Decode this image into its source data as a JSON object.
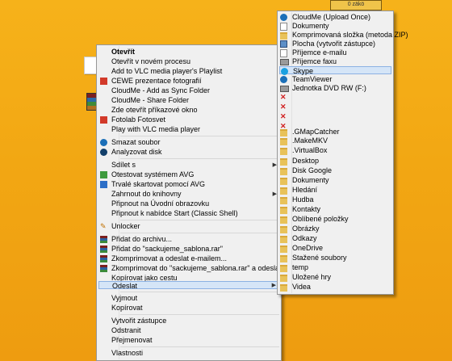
{
  "desktop": {
    "topbar_text": "0 zäkö"
  },
  "context_menu": {
    "items": [
      {
        "label": "Otevřít",
        "bold": true,
        "icon": "",
        "arrow": false
      },
      {
        "label": "Otevřít v novém procesu",
        "icon": "",
        "arrow": false
      },
      {
        "label": "Add to VLC media player's Playlist",
        "icon": "",
        "arrow": false
      },
      {
        "label": "CEWE prezentace fotografií",
        "icon": "cewe-icon",
        "arrow": false
      },
      {
        "label": "CloudMe - Add as Sync Folder",
        "icon": "",
        "arrow": false
      },
      {
        "label": "CloudMe - Share Folder",
        "icon": "",
        "arrow": false
      },
      {
        "label": "Zde otevřít příkazové okno",
        "icon": "",
        "arrow": false
      },
      {
        "label": "Fotolab Fotosvet",
        "icon": "fotolab-icon",
        "arrow": false
      },
      {
        "label": "Play with VLC media player",
        "icon": "",
        "arrow": false
      },
      {
        "label": "Smazat soubor",
        "icon": "delete-icon",
        "arrow": false
      },
      {
        "label": "Analyzovat disk",
        "icon": "analyze-icon",
        "arrow": false
      },
      {
        "label": "Sdílet s",
        "icon": "",
        "arrow": true
      },
      {
        "label": "Otestovat systémem AVG",
        "icon": "avg-icon",
        "arrow": false
      },
      {
        "label": "Trvalé skartovat pomocí AVG",
        "icon": "shred-icon",
        "arrow": false
      },
      {
        "label": "Zahrnout do knihovny",
        "icon": "",
        "arrow": true
      },
      {
        "label": "Připnout na Úvodní obrazovku",
        "icon": "",
        "arrow": false
      },
      {
        "label": "Připnout k nabídce Start (Classic Shell)",
        "icon": "",
        "arrow": false
      },
      {
        "label": "Unlocker",
        "icon": "unlocker-icon",
        "arrow": false
      },
      {
        "label": "Přidat do archivu...",
        "icon": "winrar-icon",
        "arrow": false
      },
      {
        "label": "Přidat do \"sackujeme_sablona.rar\"",
        "icon": "winrar-icon",
        "arrow": false
      },
      {
        "label": "Zkomprimovat a odeslat e-mailem...",
        "icon": "winrar-icon",
        "arrow": false
      },
      {
        "label": "Zkomprimovat do \"sackujeme_sablona.rar\" a odeslat e-mailem",
        "icon": "winrar-icon",
        "arrow": false
      },
      {
        "label": "Kopírovat jako cestu",
        "icon": "",
        "arrow": false
      },
      {
        "label": "Odeslat",
        "icon": "",
        "arrow": true,
        "highlighted": true
      },
      {
        "label": "Vyjmout",
        "icon": "",
        "arrow": false
      },
      {
        "label": "Kopírovat",
        "icon": "",
        "arrow": false
      },
      {
        "label": "Vytvořit zástupce",
        "icon": "",
        "arrow": false
      },
      {
        "label": "Odstranit",
        "icon": "",
        "arrow": false
      },
      {
        "label": "Přejmenovat",
        "icon": "",
        "arrow": false
      },
      {
        "label": "Vlastnosti",
        "icon": "",
        "arrow": false
      }
    ]
  },
  "send_to_menu": {
    "items": [
      {
        "label": "CloudMe (Upload Once)",
        "icon": "cloudme-icon"
      },
      {
        "label": "Dokumenty",
        "icon": "documents-icon"
      },
      {
        "label": "Komprimovaná složka (metoda ZIP)",
        "icon": "zip-folder-icon"
      },
      {
        "label": "Plocha (vytvořit zástupce)",
        "icon": "desktop-icon"
      },
      {
        "label": "Příjemce e-mailu",
        "icon": "mail-icon"
      },
      {
        "label": "Příjemce faxu",
        "icon": "fax-icon"
      },
      {
        "label": "Skype",
        "icon": "skype-icon",
        "highlighted": true
      },
      {
        "label": "TeamViewer",
        "icon": "teamviewer-icon"
      },
      {
        "label": "Jednotka DVD RW (F:)",
        "icon": "dvd-drive-icon"
      },
      {
        "label": "",
        "icon": "broken-shortcut-icon"
      },
      {
        "label": "",
        "icon": "broken-shortcut-icon"
      },
      {
        "label": "",
        "icon": "broken-shortcut-icon"
      },
      {
        "label": "",
        "icon": "broken-shortcut-icon"
      },
      {
        "label": ".GMapCatcher",
        "icon": "folder-icon"
      },
      {
        "label": ".MakeMKV",
        "icon": "folder-icon"
      },
      {
        "label": ".VirtualBox",
        "icon": "folder-icon"
      },
      {
        "label": "Desktop",
        "icon": "folder-icon"
      },
      {
        "label": "Disk Google",
        "icon": "folder-icon"
      },
      {
        "label": "Dokumenty",
        "icon": "folder-icon"
      },
      {
        "label": "Hledání",
        "icon": "folder-icon"
      },
      {
        "label": "Hudba",
        "icon": "folder-icon"
      },
      {
        "label": "Kontakty",
        "icon": "folder-icon"
      },
      {
        "label": "Oblíbené položky",
        "icon": "folder-icon"
      },
      {
        "label": "Obrázky",
        "icon": "folder-icon"
      },
      {
        "label": "Odkazy",
        "icon": "folder-icon"
      },
      {
        "label": "OneDrive",
        "icon": "folder-icon"
      },
      {
        "label": "Stažené soubory",
        "icon": "folder-icon"
      },
      {
        "label": "temp",
        "icon": "folder-icon"
      },
      {
        "label": "Uložené hry",
        "icon": "folder-icon"
      },
      {
        "label": "Videa",
        "icon": "folder-icon"
      }
    ]
  }
}
